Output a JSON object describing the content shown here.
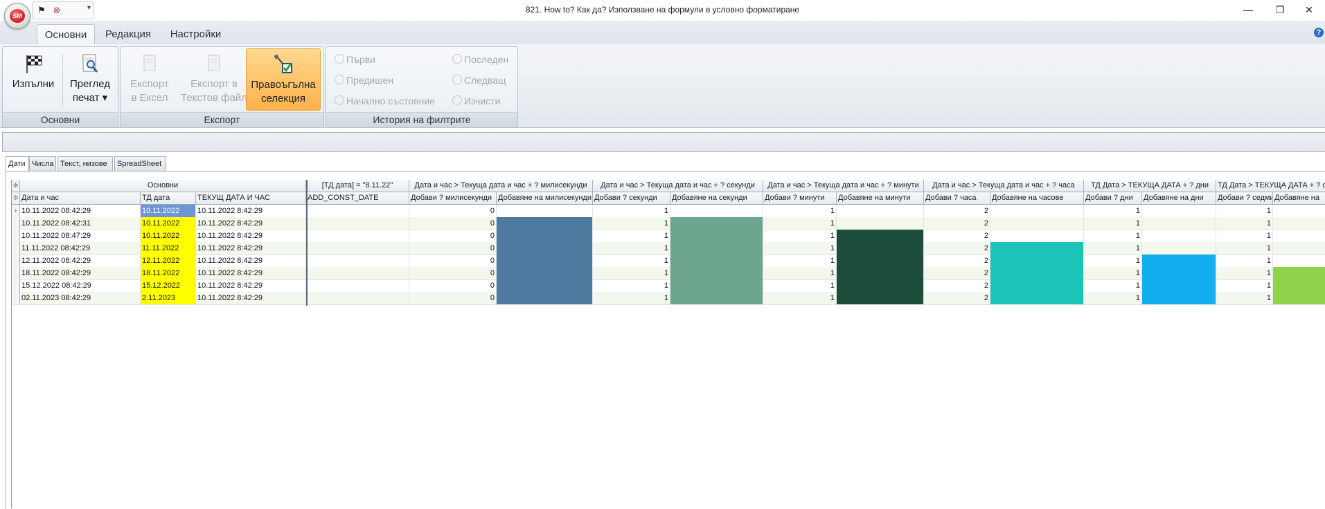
{
  "window": {
    "title": "821. How to? Как да? Използване на формули в условно форматиране"
  },
  "app_orb": {
    "label": "SM"
  },
  "quick_access": {
    "items": [
      "flag-icon",
      "close-circle-icon"
    ],
    "more": "▾"
  },
  "window_controls": {
    "minimize": "—",
    "restore": "❐",
    "close": "✕"
  },
  "ribbon": {
    "tabs": [
      "Основни",
      "Редакция",
      "Настройки"
    ],
    "groups": {
      "main": {
        "label": "Основни",
        "run": "Изпълни",
        "preview": "Преглед\nпечат ▾"
      },
      "export": {
        "label": "Експорт",
        "excel": "Експорт\nв Ексел",
        "text": "Експорт в\nТекстов файл",
        "rect": "Правоъгълна\nселекция"
      },
      "history": {
        "label": "История на филтрите",
        "first": "Първи",
        "previous": "Предишен",
        "initial": "Начално състояние",
        "last": "Последен",
        "next": "Следващ",
        "clear": "Изчисти"
      }
    }
  },
  "doc_tabs": [
    "Дати",
    "Числа",
    "Текст, низове",
    "SpreadSheet"
  ],
  "grid": {
    "corner_glyph": "✲",
    "current_row_glyph": "›",
    "band_headers": [
      "Основни",
      "[ТД дата] = \"8.11.22\"",
      "Дата и час > Текуща дата и час + ? милисекунди",
      "Дата и час > Текуща дата и час + ? секунди",
      "Дата и час > Текуща дата и час + ? минути",
      "Дата и час > Текуща дата и час + ? часа",
      "ТД Дата > ТЕКУЩА ДАТА + ? дни",
      "ТД Дата > ТЕКУЩА ДАТА + ? седмици"
    ],
    "columns": [
      "Дата и час",
      "ТД дата",
      "ТЕКУЩ ДАТА И ЧАС",
      "ADD_CONST_DATE",
      "Добави ? милисекунди",
      "Добавяне на милисекунди",
      "Добави ? секунди",
      "Добавяне на секунди",
      "Добави ? минути",
      "Добавяне на минути",
      "Добави ? часа",
      "Добавяне на часове",
      "Добави ? дни",
      "Добавяне на дни",
      "Добави ? седмици",
      "Добавяне на"
    ],
    "rows": [
      [
        "10.11.2022 08:42:29",
        "10.11.2022",
        "10.11.2022 8:42:29",
        "",
        "0",
        "",
        "1",
        "",
        "1",
        "",
        "2",
        "",
        "1",
        "",
        "1",
        ""
      ],
      [
        "10.11.2022 08:42:31",
        "10.11.2022",
        "10.11.2022 8:42:29",
        "",
        "0",
        "",
        "1",
        "",
        "1",
        "",
        "2",
        "",
        "1",
        "",
        "1",
        ""
      ],
      [
        "10.11.2022 08:47:29",
        "10.11.2022",
        "10.11.2022 8:42:29",
        "",
        "0",
        "",
        "1",
        "",
        "1",
        "",
        "2",
        "",
        "1",
        "",
        "1",
        ""
      ],
      [
        "11.11.2022 08:42:29",
        "11.11.2022",
        "10.11.2022 8:42:29",
        "",
        "0",
        "",
        "1",
        "",
        "1",
        "",
        "2",
        "",
        "1",
        "",
        "1",
        ""
      ],
      [
        "12.11.2022 08:42:29",
        "12.11.2022",
        "10.11.2022 8:42:29",
        "",
        "0",
        "",
        "1",
        "",
        "1",
        "",
        "2",
        "",
        "1",
        "",
        "1",
        ""
      ],
      [
        "18.11.2022 08:42:29",
        "18.11.2022",
        "10.11.2022 8:42:29",
        "",
        "0",
        "",
        "1",
        "",
        "1",
        "",
        "2",
        "",
        "1",
        "",
        "1",
        ""
      ],
      [
        "15.12.2022 08:42:29",
        "15.12.2022",
        "10.11.2022 8:42:29",
        "",
        "0",
        "",
        "1",
        "",
        "1",
        "",
        "2",
        "",
        "1",
        "",
        "1",
        ""
      ],
      [
        "02.11.2023 08:42:29",
        "2.11.2023",
        "10.11.2022 8:42:29",
        "",
        "0",
        "",
        "1",
        "",
        "1",
        "",
        "2",
        "",
        "1",
        "",
        "1",
        ""
      ]
    ],
    "highlight_colors": {
      "selected_cell": "#6f95d6",
      "yellow": "#ffff00",
      "milliseconds": "#4f7aa0",
      "seconds": "#6ea58e",
      "minutes": "#1b4d3a",
      "hours": "#1cc3b9",
      "days": "#12aef0",
      "weeks": "#8fd24c"
    },
    "highlights": {
      "td_date_yellow_rows": [
        1,
        2,
        3,
        4,
        5,
        6,
        7
      ],
      "td_date_selected_row": 0,
      "milliseconds_from_row": 1,
      "seconds_from_row": 1,
      "minutes_from_row": 2,
      "hours_from_row": 3,
      "days_from_row": 4,
      "weeks_from_row": 5
    }
  }
}
